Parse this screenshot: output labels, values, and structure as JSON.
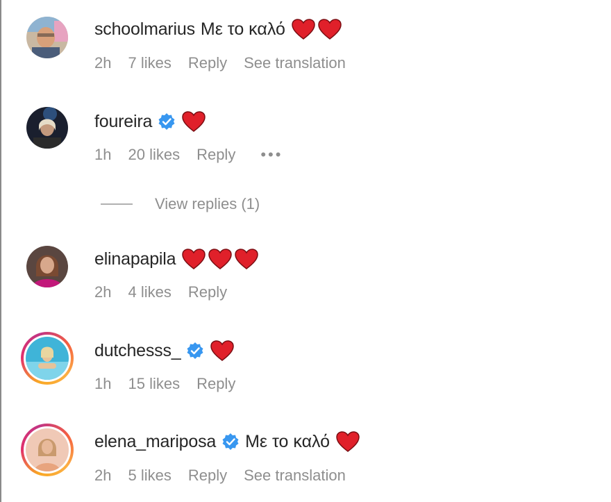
{
  "comments": [
    {
      "username": "schoolmarius",
      "verified": false,
      "text": "Με το καλό",
      "hearts": 2,
      "time": "2h",
      "likes": "7 likes",
      "reply": "Reply",
      "translation": "See translation"
    },
    {
      "username": "foureira",
      "verified": true,
      "text": "",
      "hearts": 1,
      "time": "1h",
      "likes": "20 likes",
      "reply": "Reply",
      "more": "•••"
    },
    {
      "username": "elinapapila",
      "verified": false,
      "text": "",
      "hearts": 3,
      "time": "2h",
      "likes": "4 likes",
      "reply": "Reply"
    },
    {
      "username": "dutchesss_",
      "verified": true,
      "story_ring": true,
      "text": "",
      "hearts": 1,
      "time": "1h",
      "likes": "15 likes",
      "reply": "Reply"
    },
    {
      "username": "elena_mariposa",
      "verified": true,
      "story_ring": true,
      "text": "Με το καλό",
      "hearts": 1,
      "time": "2h",
      "likes": "5 likes",
      "reply": "Reply",
      "translation": "See translation"
    }
  ],
  "view_replies": "View replies (1)",
  "colors": {
    "text": "#262626",
    "meta": "#8e8e8e",
    "verified": "#3897f0",
    "heart": "#e0202a"
  },
  "icons": {
    "verified": "verified-badge-icon",
    "heart": "red-heart-emoji",
    "more": "more-options-icon"
  }
}
